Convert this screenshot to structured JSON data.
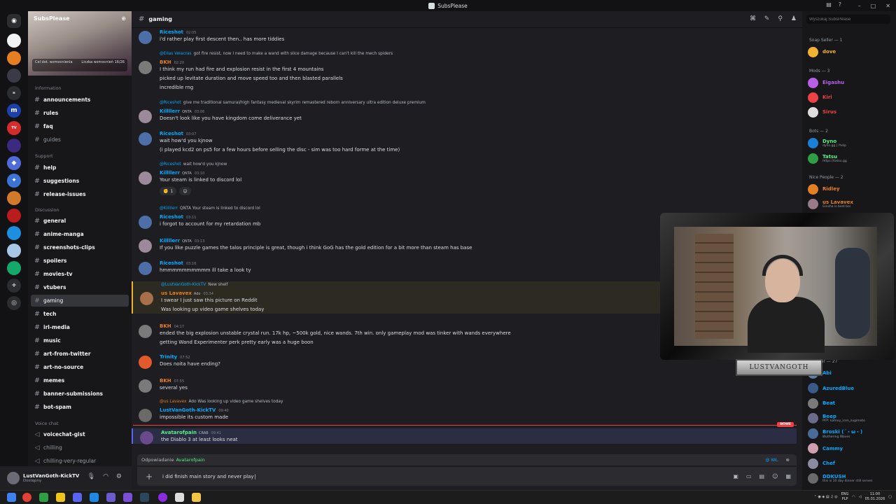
{
  "window": {
    "title": "SubsPlease"
  },
  "server": {
    "name": "SubsPlease",
    "boost_left": "Cel dot. wzmocnienia",
    "boost_right": "Liczba wzmocnień",
    "boost_count": "16/26"
  },
  "categories": {
    "information": "Information",
    "support": "Support",
    "discussion": "Discussion",
    "voice": "Voice chat"
  },
  "channels": [
    {
      "name": "announcements",
      "state": "bright"
    },
    {
      "name": "rules",
      "state": "bright"
    },
    {
      "name": "faq",
      "state": "bright"
    },
    {
      "name": "guides",
      "state": "muted"
    },
    {
      "name": "help",
      "state": "bright"
    },
    {
      "name": "suggestions",
      "state": "bright"
    },
    {
      "name": "release-issues",
      "state": "bright"
    },
    {
      "name": "general",
      "state": "bright"
    },
    {
      "name": "anime-manga",
      "state": "bright"
    },
    {
      "name": "screenshots-clips",
      "state": "bright"
    },
    {
      "name": "spoilers",
      "state": "bright"
    },
    {
      "name": "movies-tv",
      "state": "bright"
    },
    {
      "name": "vtubers",
      "state": "bright"
    },
    {
      "name": "gaming",
      "state": "active"
    },
    {
      "name": "tech",
      "state": "bright"
    },
    {
      "name": "irl-media",
      "state": "bright"
    },
    {
      "name": "music",
      "state": "bright"
    },
    {
      "name": "art-from-twitter",
      "state": "bright"
    },
    {
      "name": "art-no-source",
      "state": "bright"
    },
    {
      "name": "memes",
      "state": "bright"
    },
    {
      "name": "banner-submissions",
      "state": "bright"
    },
    {
      "name": "bot-spam",
      "state": "bright"
    },
    {
      "name": "voicechat-gist",
      "state": "bright"
    },
    {
      "name": "chilling",
      "state": "muted"
    },
    {
      "name": "chilling-very-regular",
      "state": "muted"
    }
  ],
  "user": {
    "name": "LustVanGoth-KickTV",
    "status": "Dostępny"
  },
  "chat": {
    "channel": "gaming",
    "messages": [
      {
        "author": "Riceshot",
        "color": "#00a8fc",
        "time": "02:05",
        "lines": [
          "i'd rather play first descent then.. has more tiddies"
        ]
      },
      {
        "reply_to": "@Elias Velacras",
        "reply_text": "got fire resist, now I need to make a wand with slice damage because I can't kill the mech spiders",
        "author": "BKH",
        "color": "#e67e22",
        "time": "02:20",
        "lines": [
          "I think my run had fire and explosion resist in the first 4 mountains",
          "picked up  levitate duration and move speed too and then blasted parallels",
          "incredible rng"
        ]
      },
      {
        "reply_to": "@Riceshot",
        "reply_text": "give me traditional samurai/high fantasy medieval skyrim remastered reborn anniversary ultra edition deluxe premium",
        "author": "Killllerr",
        "badge": "QNTA",
        "color": "#00a8fc",
        "time": "03:06",
        "lines": [
          "Doesn't look like you have kingdom come deliverance yet"
        ]
      },
      {
        "author": "Riceshot",
        "color": "#00a8fc",
        "time": "03:07",
        "lines": [
          "wait how'd you kjnow",
          "(i played kcd2 on ps5 for a few hours before selling the disc - sim was too hard forme at the time)"
        ]
      },
      {
        "reply_to": "@Riceshot",
        "reply_text": "wait how'd you kjnow",
        "author": "Killllerr",
        "badge": "QNTA",
        "color": "#00a8fc",
        "time": "03:10",
        "lines": [
          "Your steam is linked to discord lol"
        ],
        "reaction_count": "1"
      },
      {
        "reply_to": "@Killllerr",
        "reply_text": "QNTA  Your steam is linked to discord lol",
        "author": "Riceshot",
        "color": "#00a8fc",
        "time": "03:11",
        "lines": [
          "i forgot to account for my retardation mb"
        ]
      },
      {
        "author": "Killllerr",
        "badge": "QNTA",
        "color": "#00a8fc",
        "time": "03:13",
        "lines": [
          "If you like puzzle games the talos principle is great, though i think GoG has the gold edition for a bit more than steam has base"
        ]
      },
      {
        "author": "Riceshot",
        "color": "#00a8fc",
        "time": "03:16",
        "lines": [
          "hmmmmmmmmmm ill take a look ty"
        ]
      },
      {
        "reply_to": "@LustVanGoth-KickTV",
        "reply_text": "New shelf",
        "author": "us Lavavex",
        "badge": "Ado",
        "color": "#e67e22",
        "time": "03:34",
        "lines": [
          "I swear I just saw this picture on Reddit",
          "Was looking up video game shelves today"
        ]
      },
      {
        "author": "BKH",
        "color": "#e67e22",
        "time": "04:17",
        "lines": [
          "ended the big explosion unstable crystal run. 17k hp, ~500k gold, nice wands. 7th win. only gameplay mod was tinker with wands everywhere",
          "getting Wand Experimenter perk pretty early was a huge boon"
        ]
      },
      {
        "author": "Trinity",
        "color": "#00a8fc",
        "time": "07:52",
        "lines": [
          "Does noita have ending?"
        ]
      },
      {
        "author": "BKH",
        "color": "#e67e22",
        "time": "07:55",
        "lines": [
          "several yes"
        ]
      },
      {
        "reply_to": "@us Lavavex",
        "reply_text": "Ado  Was looking up video game shelves today",
        "author": "LustVanGoth-KickTV",
        "color": "#00a8fc",
        "time": "09:40",
        "lines": [
          "impossible its custom made"
        ]
      },
      {
        "author": "Avatarofpain",
        "badge": "CRAB",
        "color": "#57f287",
        "time": "09:41",
        "lines": [
          "the Diablo 3 at least looks neat"
        ]
      }
    ],
    "new_label": "NOWE"
  },
  "reply_bar": {
    "prefix": "Odpowiadanie",
    "target": "Avatarofpain",
    "mention": "@ WŁ."
  },
  "composer": {
    "text": "i did finish main story and never play"
  },
  "members": {
    "search_placeholder": "Wyszukaj SubsPlease",
    "groups": [
      {
        "title": "Soap Seller — 1",
        "items": [
          {
            "name": "dove",
            "color": "#f0b232",
            "sub": ""
          }
        ]
      },
      {
        "title": "Mods — 3",
        "items": [
          {
            "name": "Eigashu",
            "color": "#b660e6",
            "sub": ""
          },
          {
            "name": "Kiri",
            "color": "#ed4245",
            "sub": ""
          },
          {
            "name": "Sirus",
            "color": "#ed4245",
            "sub": ""
          }
        ]
      },
      {
        "title": "Bots — 2",
        "items": [
          {
            "name": "Dyno",
            "color": "#57f287",
            "sub": "dyno.gg | !help"
          },
          {
            "name": "Tatsu",
            "color": "#57f287",
            "sub": "https://tatsu.gg"
          }
        ]
      },
      {
        "title": "Nice People — 2",
        "items": [
          {
            "name": "Ridley",
            "color": "#e67e22",
            "sub": ""
          },
          {
            "name": "us Lavavex",
            "color": "#e67e22",
            "sub": "Ginsha is best boi"
          }
        ]
      },
      {
        "title": "Regular — 27",
        "items": [
          {
            "name": "Abi",
            "color": "#00a8fc",
            "sub": ""
          },
          {
            "name": "AzuredBlue",
            "color": "#00a8fc",
            "sub": ""
          },
          {
            "name": "Beat",
            "color": "#00a8fc",
            "sub": ""
          },
          {
            "name": "Beep",
            "color": "#00a8fc",
            "sub": "PFP: kamuy_icon_sugimoto"
          },
          {
            "name": "Broski (´・ω・)",
            "color": "#00a8fc",
            "sub": "Wuthering Waves"
          },
          {
            "name": "Cammy",
            "color": "#00a8fc",
            "sub": ""
          },
          {
            "name": "Chef",
            "color": "#00a8fc",
            "sub": ""
          },
          {
            "name": "DDKUSH",
            "color": "#00a8fc",
            "sub": "this is 10 day dinner still serves"
          }
        ]
      }
    ]
  },
  "webcam": {
    "nameplate": "LUSTVANGOTH"
  },
  "taskbar": {
    "lang": "ENG",
    "lang2": "PLP",
    "time": "11:00",
    "date": "05.01.2026"
  }
}
